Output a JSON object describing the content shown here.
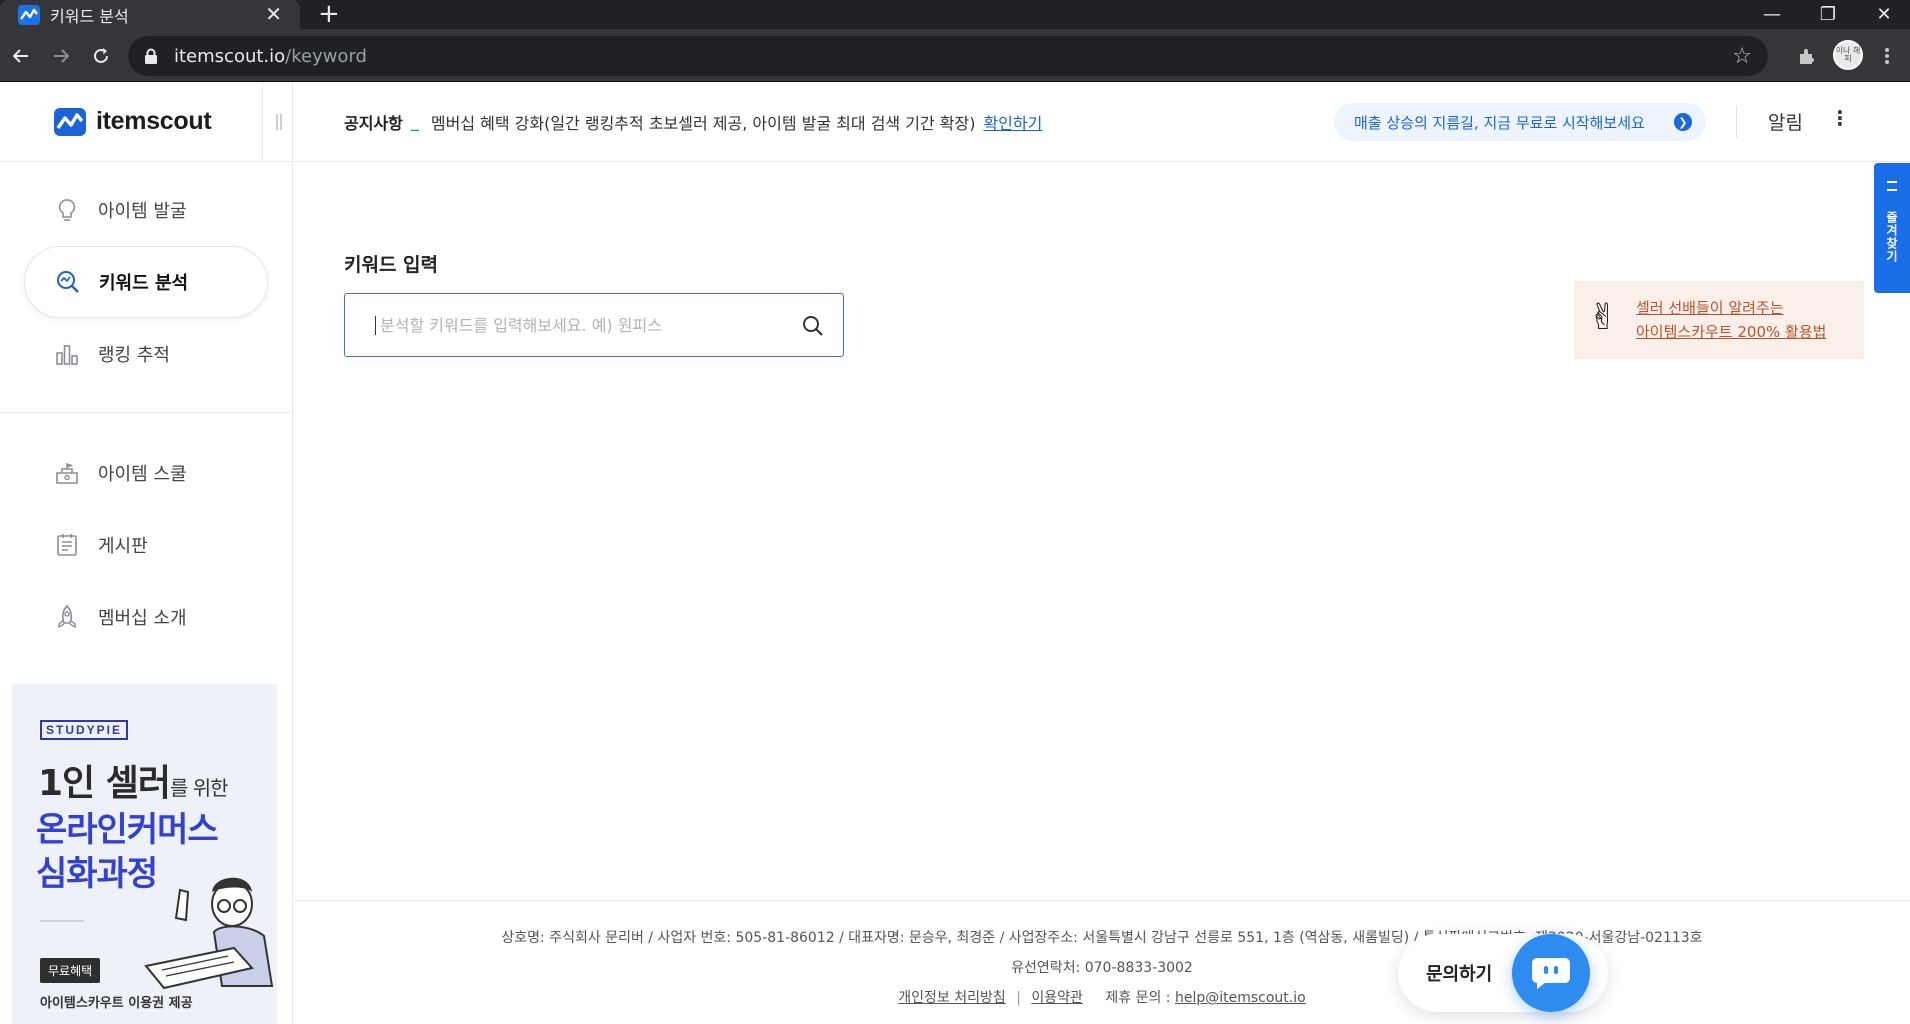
{
  "browser": {
    "tab_title": "키워드 분석",
    "tab_close": "✕",
    "new_tab": "+",
    "url_host": "itemscout.io",
    "url_path": "/keyword",
    "profile_text": "이나 해피",
    "window_min": "—",
    "window_restore": "❐",
    "window_close": "✕"
  },
  "logo": {
    "text": "itemscout"
  },
  "sidebar": {
    "items": [
      {
        "label": "아이템 발굴",
        "icon": "lightbulb-icon"
      },
      {
        "label": "키워드 분석",
        "icon": "keyword-search-icon",
        "active": true
      },
      {
        "label": "랭킹 추적",
        "icon": "bar-chart-icon"
      }
    ],
    "items2": [
      {
        "label": "아이템 스쿨",
        "icon": "school-icon"
      },
      {
        "label": "게시판",
        "icon": "board-icon"
      },
      {
        "label": "멤버십 소개",
        "icon": "rocket-icon"
      }
    ]
  },
  "banner": {
    "brand": "STUDYPIE",
    "line1_main": "1인 셀러",
    "line1_sub": "를 위한",
    "line2": "온라인커머스",
    "line3": "심화과정",
    "badge": "무료혜택",
    "footer": "아이템스카우트 이용권 제공"
  },
  "topbar": {
    "notice_label": "공지사항",
    "notice_sep": "_",
    "notice_text": "멤버십 혜택 강화(일간 랭킹추적 초보셀러 제공, 아이템 발굴 최대 검색 기간 확장)",
    "notice_link": "확인하기",
    "promo": "매출 상승의 지름길, 지금 무료로 시작해보세요",
    "notifications": "알림",
    "more": "⋮"
  },
  "main": {
    "section_label": "키워드 입력",
    "search_placeholder": "분석할 키워드를 입력해보세요. 예) 원피스",
    "search_value": "",
    "tip_line1": "셀러 선배들이 알려주는",
    "tip_line2": "아이템스카우트 200% 활용법",
    "tip_emoji": "✌",
    "bookmark": "즐겨찾기"
  },
  "footer": {
    "line1": "상호명: 주식회사 문리버 / 사업자 번호: 505-81-86012 / 대표자명: 문승우, 최경준 / 사업장주소: 서울특별시 강남구 선릉로 551, 1층 (역삼동, 새롬빌딩) / 통신판매신고번호: 제2020-서울강남-02113호",
    "line2": "유선연락처: 070-8833-3002",
    "privacy": "개인정보 처리방침",
    "divider": "|",
    "terms": "이용약관",
    "contact_label": "제휴 문의 :",
    "contact_email": "help@itemscout.io"
  },
  "chat": {
    "label": "문의하기"
  },
  "colors": {
    "accent": "#1a6ee8",
    "brand_blue": "#3340d6",
    "tip_text": "#b7542f"
  }
}
